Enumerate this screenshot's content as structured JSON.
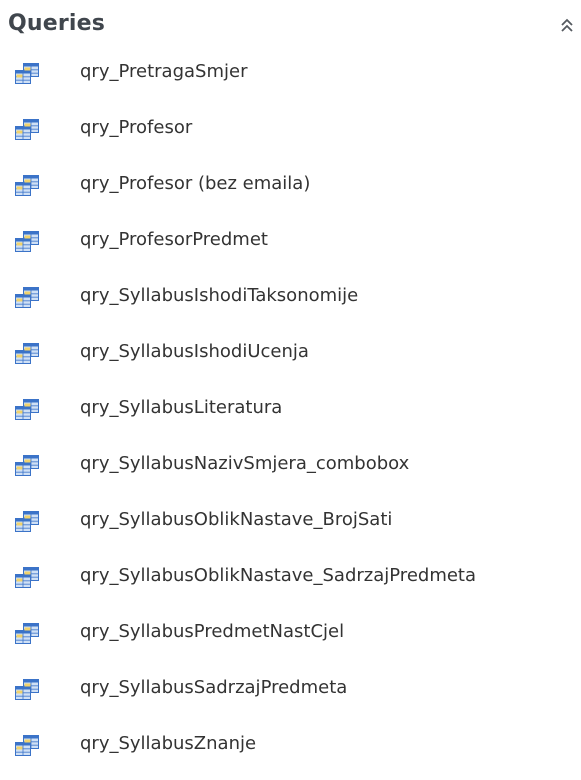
{
  "nav_pane": {
    "section_title": "Queries",
    "collapse_icon": "double-chevron-up-icon",
    "item_icon": "query-icon",
    "colors": {
      "icon_blue": "#3b73c8",
      "icon_light": "#cfe0f5",
      "icon_yellow": "#f2d36b",
      "text": "#333333",
      "title": "#40464d"
    },
    "items": [
      {
        "label": "qry_PretragaSmjer"
      },
      {
        "label": "qry_Profesor"
      },
      {
        "label": "qry_Profesor (bez emaila)"
      },
      {
        "label": "qry_ProfesorPredmet"
      },
      {
        "label": "qry_SyllabusIshodiTaksonomije"
      },
      {
        "label": "qry_SyllabusIshodiUcenja"
      },
      {
        "label": "qry_SyllabusLiteratura"
      },
      {
        "label": "qry_SyllabusNazivSmjera_combobox"
      },
      {
        "label": "qry_SyllabusOblikNastave_BrojSati"
      },
      {
        "label": "qry_SyllabusOblikNastave_SadrzajPredmeta"
      },
      {
        "label": "qry_SyllabusPredmetNastCjel"
      },
      {
        "label": "qry_SyllabusSadrzajPredmeta"
      },
      {
        "label": "qry_SyllabusZnanje"
      }
    ]
  }
}
